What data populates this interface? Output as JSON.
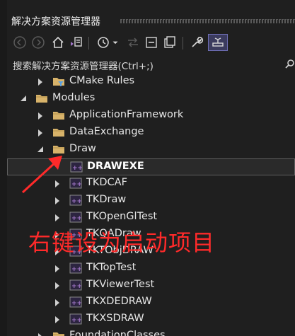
{
  "panel": {
    "title": "解决方案资源管理器",
    "search_label": "搜索解决方案资源管理器(Ctrl+;)"
  },
  "toolbar": {
    "buttons": [
      "back-icon",
      "forward-icon",
      "home-icon",
      "switch-views-icon",
      "history-icon",
      "dropdown-icon",
      "sync-icon",
      "collapse-all-icon",
      "show-all-files-icon",
      "properties-icon",
      "preview-icon"
    ]
  },
  "tree": {
    "items": [
      {
        "label": "CMake Rules",
        "depth": 2,
        "expanded": false,
        "icon": "filter-folder-icon"
      },
      {
        "label": "Modules",
        "depth": 1,
        "expanded": true,
        "icon": "folder-icon"
      },
      {
        "label": "ApplicationFramework",
        "depth": 2,
        "expanded": false,
        "icon": "folder-icon"
      },
      {
        "label": "DataExchange",
        "depth": 2,
        "expanded": false,
        "icon": "folder-icon"
      },
      {
        "label": "Draw",
        "depth": 2,
        "expanded": true,
        "icon": "folder-icon"
      },
      {
        "label": "DRAWEXE",
        "depth": 3,
        "expanded": null,
        "icon": "cpp-project-icon",
        "selected": true,
        "bold": true
      },
      {
        "label": "TKDCAF",
        "depth": 3,
        "expanded": false,
        "icon": "cpp-project-icon"
      },
      {
        "label": "TKDraw",
        "depth": 3,
        "expanded": false,
        "icon": "cpp-project-icon"
      },
      {
        "label": "TKOpenGlTest",
        "depth": 3,
        "expanded": false,
        "icon": "cpp-project-icon"
      },
      {
        "label": "TKQADraw",
        "depth": 3,
        "expanded": false,
        "icon": "cpp-project-icon"
      },
      {
        "label": "TKTObjDRAW",
        "depth": 3,
        "expanded": false,
        "icon": "cpp-project-icon"
      },
      {
        "label": "TKTopTest",
        "depth": 3,
        "expanded": false,
        "icon": "cpp-project-icon"
      },
      {
        "label": "TKViewerTest",
        "depth": 3,
        "expanded": false,
        "icon": "cpp-project-icon"
      },
      {
        "label": "TKXDEDRAW",
        "depth": 3,
        "expanded": false,
        "icon": "cpp-project-icon"
      },
      {
        "label": "TKXSDRAW",
        "depth": 3,
        "expanded": false,
        "icon": "cpp-project-icon"
      },
      {
        "label": "FoundationClasses",
        "depth": 2,
        "expanded": false,
        "icon": "folder-icon"
      }
    ]
  },
  "annotation": {
    "text": "右键设为启动项目",
    "color": "#ff2a2a"
  },
  "colors": {
    "background": "#1f1f1f",
    "accent_active": "#6e6eb4",
    "folder": "#d8b36a",
    "project": "#a277c9"
  }
}
